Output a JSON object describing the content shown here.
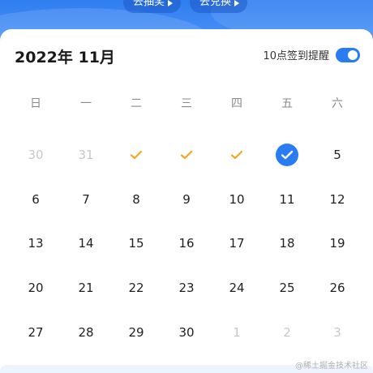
{
  "header": {
    "pill_draw": "去抽奖",
    "pill_redeem": "去兑换"
  },
  "calendar": {
    "month_title": "2022年 11月",
    "reminder_label": "10点签到提醒",
    "reminder_enabled": true,
    "weekdays": [
      "日",
      "一",
      "二",
      "三",
      "四",
      "五",
      "六"
    ],
    "days": [
      {
        "label": "30",
        "state": "muted"
      },
      {
        "label": "31",
        "state": "muted"
      },
      {
        "label": "",
        "state": "checked"
      },
      {
        "label": "",
        "state": "checked"
      },
      {
        "label": "",
        "state": "checked"
      },
      {
        "label": "",
        "state": "today-checked"
      },
      {
        "label": "5",
        "state": "normal"
      },
      {
        "label": "6",
        "state": "normal"
      },
      {
        "label": "7",
        "state": "normal"
      },
      {
        "label": "8",
        "state": "normal"
      },
      {
        "label": "9",
        "state": "normal"
      },
      {
        "label": "10",
        "state": "normal"
      },
      {
        "label": "11",
        "state": "normal"
      },
      {
        "label": "12",
        "state": "normal"
      },
      {
        "label": "13",
        "state": "normal"
      },
      {
        "label": "14",
        "state": "normal"
      },
      {
        "label": "15",
        "state": "normal"
      },
      {
        "label": "16",
        "state": "normal"
      },
      {
        "label": "17",
        "state": "normal"
      },
      {
        "label": "18",
        "state": "normal"
      },
      {
        "label": "19",
        "state": "normal"
      },
      {
        "label": "20",
        "state": "normal"
      },
      {
        "label": "21",
        "state": "normal"
      },
      {
        "label": "22",
        "state": "normal"
      },
      {
        "label": "23",
        "state": "normal"
      },
      {
        "label": "24",
        "state": "normal"
      },
      {
        "label": "25",
        "state": "normal"
      },
      {
        "label": "26",
        "state": "normal"
      },
      {
        "label": "27",
        "state": "normal"
      },
      {
        "label": "28",
        "state": "normal"
      },
      {
        "label": "29",
        "state": "normal"
      },
      {
        "label": "30",
        "state": "normal"
      },
      {
        "label": "1",
        "state": "muted"
      },
      {
        "label": "2",
        "state": "muted"
      },
      {
        "label": "3",
        "state": "muted"
      }
    ]
  },
  "colors": {
    "accent": "#2a7cf2",
    "check_orange": "#f5a623",
    "muted_text": "#c8c8c8"
  },
  "watermark": "@稀土掘金技术社区"
}
